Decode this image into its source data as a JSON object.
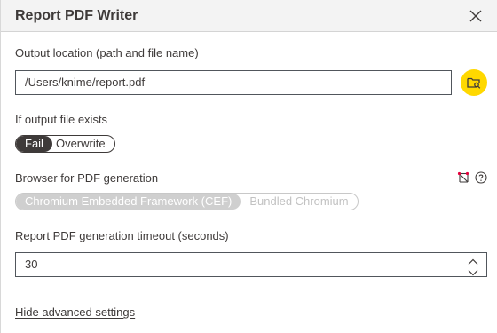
{
  "dialog": {
    "title": "Report PDF Writer"
  },
  "output_location": {
    "label": "Output location (path and file name)",
    "value": "/Users/knime/report.pdf"
  },
  "if_exists": {
    "label": "If output file exists",
    "options": [
      "Fail",
      "Overwrite"
    ],
    "selected": "Fail"
  },
  "browser": {
    "label": "Browser for PDF generation",
    "options": [
      "Chromium Embedded Framework (CEF)",
      "Bundled Chromium"
    ],
    "selected": "Chromium Embedded Framework (CEF)"
  },
  "timeout": {
    "label": "Report PDF generation timeout (seconds)",
    "value": "30"
  },
  "advanced_link": "Hide advanced settings",
  "colors": {
    "accent_yellow": "#ffd800",
    "text": "#3e3a39",
    "flow_variable_icon": "#e5003c"
  }
}
